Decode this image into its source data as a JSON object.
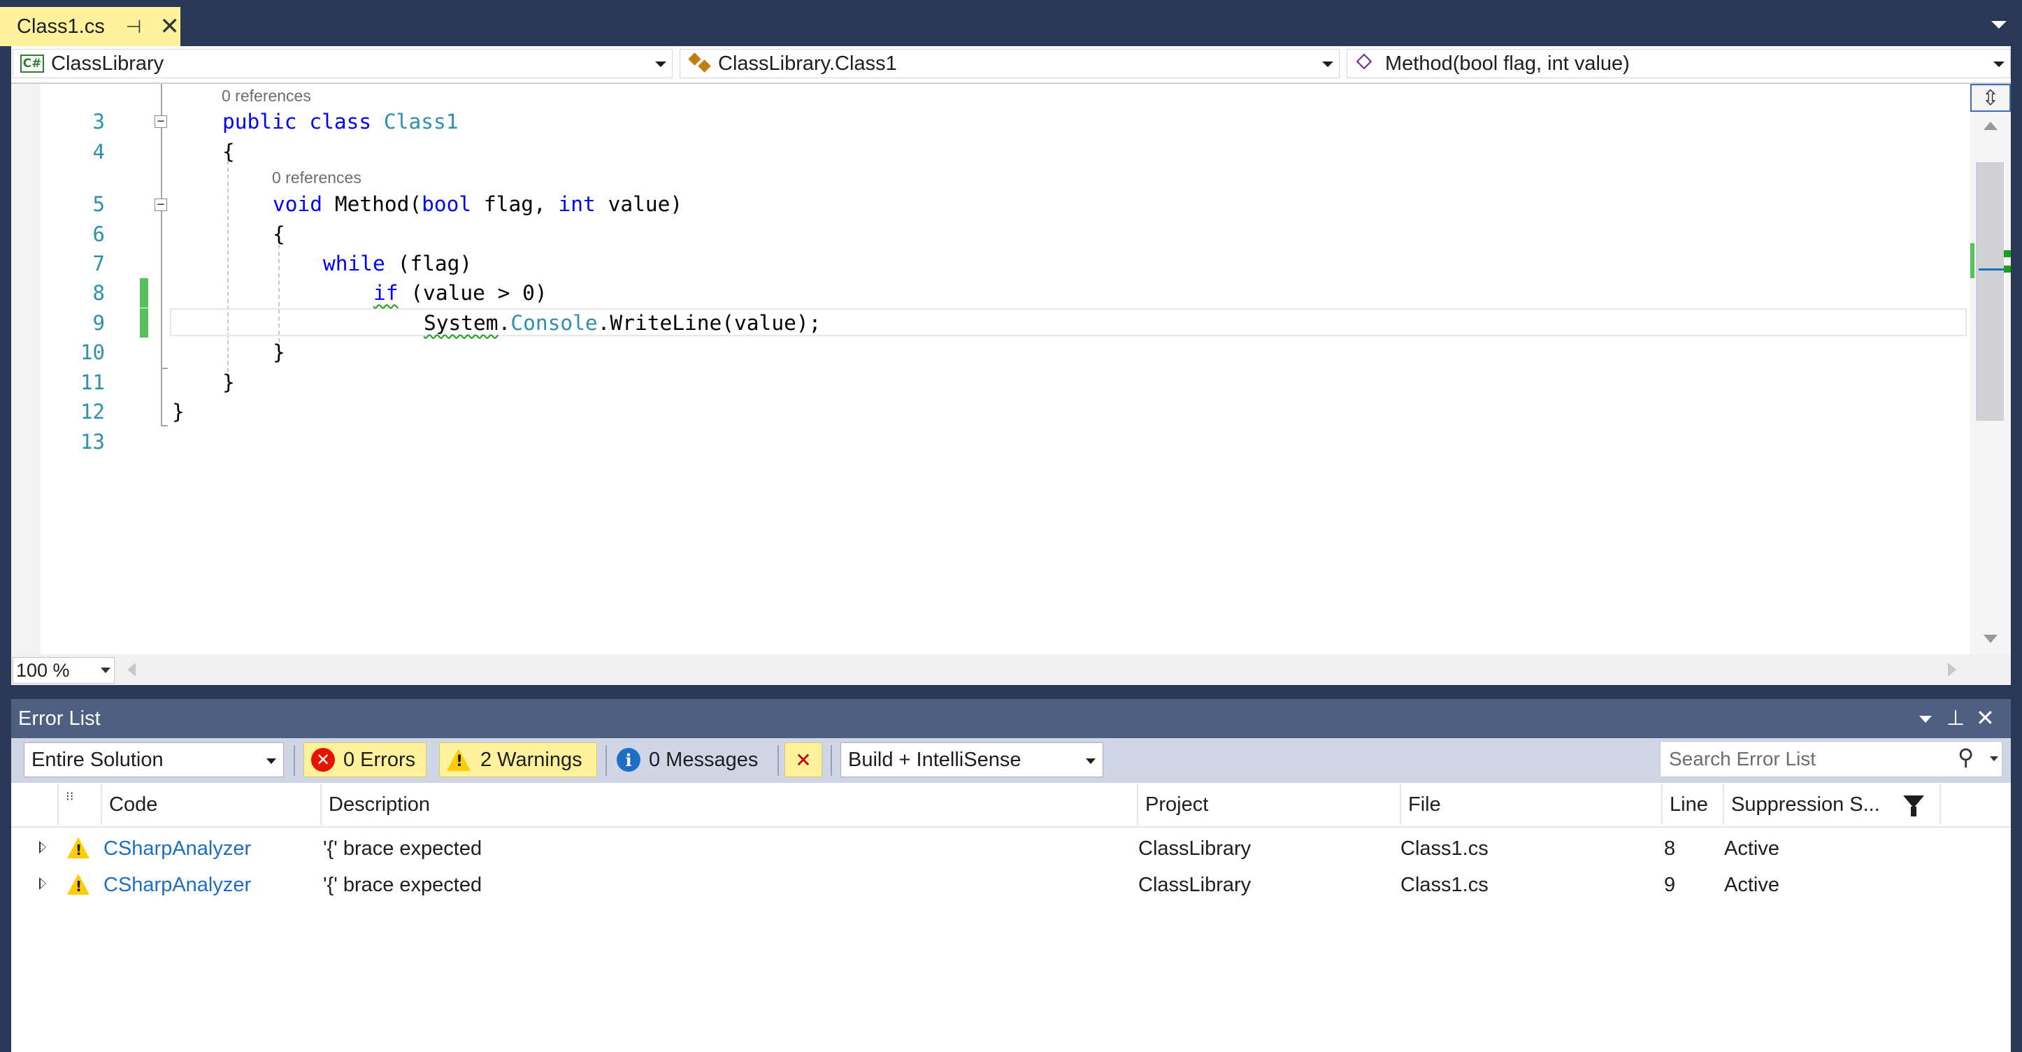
{
  "tab": {
    "title": "Class1.cs",
    "pin_glyph": "⊣",
    "close_glyph": "✕"
  },
  "nav": {
    "project": "ClassLibrary",
    "type": "ClassLibrary.Class1",
    "member": "Method(bool flag, int value)",
    "project_icon": "C#"
  },
  "editor": {
    "line_numbers": [
      "3",
      "4",
      "5",
      "6",
      "7",
      "8",
      "9",
      "10",
      "11",
      "12",
      "13"
    ],
    "references_label": "0 references",
    "lines": {
      "l3": [
        "public",
        "class",
        "Class1"
      ],
      "l4": "{",
      "l5": [
        "void",
        "Method(",
        "bool",
        "flag,",
        "int",
        "value)"
      ],
      "l6": "{",
      "l7": [
        "while",
        "(flag)"
      ],
      "l8": [
        "if",
        "(value > 0)"
      ],
      "l9": [
        "System",
        ".",
        "Console",
        ".WriteLine(value);"
      ],
      "l10": "}",
      "l11": "}",
      "l12": "}"
    },
    "zoom": "100 %"
  },
  "error_list": {
    "title": "Error List",
    "scope": "Entire Solution",
    "errors_label": "0 Errors",
    "warnings_label": "2 Warnings",
    "messages_label": "0 Messages",
    "build_filter": "Build + IntelliSense",
    "search_placeholder": "Search Error List",
    "columns": {
      "code": "Code",
      "description": "Description",
      "project": "Project",
      "file": "File",
      "line": "Line",
      "suppression": "Suppression S..."
    },
    "rows": [
      {
        "code": "CSharpAnalyzer",
        "description": "'{' brace expected",
        "project": "ClassLibrary",
        "file": "Class1.cs",
        "line": "8",
        "suppression": "Active"
      },
      {
        "code": "CSharpAnalyzer",
        "description": "'{' brace expected",
        "project": "ClassLibrary",
        "file": "Class1.cs",
        "line": "9",
        "suppression": "Active"
      }
    ]
  },
  "colors": {
    "chrome": "#293955",
    "active_tab": "#fff29d",
    "keyword": "#0000ff",
    "type": "#2b91af",
    "change_bar": "#57c15c",
    "warning": "#ffcc00",
    "error": "#e51400",
    "link": "#1e6fc4"
  }
}
